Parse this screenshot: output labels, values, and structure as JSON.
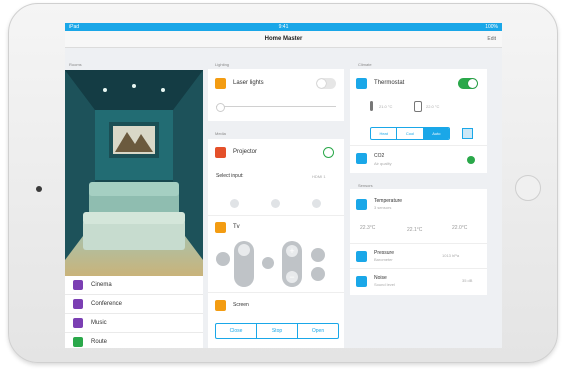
{
  "statusbar": {
    "left": "iPad",
    "time": "9:41",
    "right": "100%"
  },
  "navbar": {
    "title": "Home Master",
    "edit": "Edit"
  },
  "columns": {
    "rooms": "Rooms",
    "lighting": "Lighting",
    "climate": "Climate",
    "media": "Media",
    "sensors": "Sensors"
  },
  "rooms": [
    {
      "label": "Cinema",
      "color": "#7b3fb3"
    },
    {
      "label": "Conference",
      "color": "#7b3fb3"
    },
    {
      "label": "Music",
      "color": "#7b3fb3"
    },
    {
      "label": "Route",
      "color": "#2aa84a"
    }
  ],
  "lighting": {
    "name": "Laser lights",
    "on": false
  },
  "projector": {
    "name": "Projector",
    "source_label": "Select input:",
    "source_value": "HDMI 1"
  },
  "tv": {
    "name": "Tv"
  },
  "screen": {
    "name": "Screen",
    "buttons": [
      "Close",
      "Stop",
      "Open"
    ]
  },
  "thermostat": {
    "name": "Thermostat",
    "on": true,
    "temp_current": "21.0 °C",
    "temp_target": "22.0 °C",
    "modes": [
      "Heat",
      "Cool",
      "Auto"
    ],
    "active_mode": "Auto"
  },
  "co2": {
    "name": "CO2",
    "sub": "Air quality",
    "status_color": "#2aa84a"
  },
  "temperature": {
    "name": "Temperature",
    "sub": "3 sensors",
    "readings": [
      "22.3°C",
      "22.1°C",
      "22.0°C"
    ]
  },
  "pressure": {
    "name": "Pressure",
    "sub": "Barometer",
    "value": "1013 hPa"
  },
  "noise": {
    "name": "Noise",
    "sub": "Sound level",
    "value": "35 dB"
  },
  "colors": {
    "accent": "#1aa7e8",
    "orange": "#f39c12",
    "green": "#2aa84a",
    "purple": "#7b3fb3"
  }
}
